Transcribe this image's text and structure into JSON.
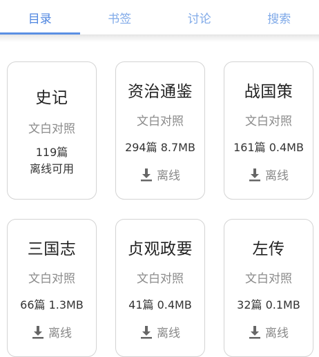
{
  "tabs": [
    {
      "label": "目录",
      "active": true
    },
    {
      "label": "书签",
      "active": false
    },
    {
      "label": "讨论",
      "active": false
    },
    {
      "label": "搜索",
      "active": false
    }
  ],
  "books": [
    {
      "title": "史记",
      "subtitle": "文白对照",
      "count_line": "119篇",
      "status_line": "离线可用"
    },
    {
      "title": "资治通鉴",
      "subtitle": "文白对照",
      "meta": "294篇 8.7MB",
      "action": "离线"
    },
    {
      "title": "战国策",
      "subtitle": "文白对照",
      "meta": "161篇 0.4MB",
      "action": "离线"
    },
    {
      "title": "三国志",
      "subtitle": "文白对照",
      "meta": "66篇 1.3MB",
      "action": "离线"
    },
    {
      "title": "贞观政要",
      "subtitle": "文白对照",
      "meta": "41篇 0.4MB",
      "action": "离线"
    },
    {
      "title": "左传",
      "subtitle": "文白对照",
      "meta": "32篇 0.1MB",
      "action": "离线"
    }
  ],
  "colors": {
    "accent": "#5a8fe3",
    "tab_inactive": "#7fa9e8",
    "icon": "#666666"
  },
  "icons": {
    "download": "download-icon"
  }
}
